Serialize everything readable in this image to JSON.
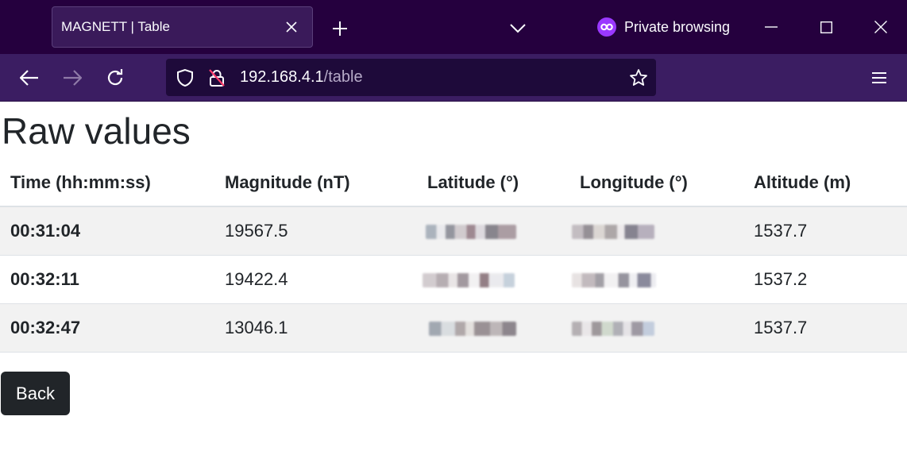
{
  "browser": {
    "tab_title": "MAGNETT | Table",
    "private_label": "Private browsing",
    "url_host": "192.168.4.1",
    "url_path": "/table",
    "icons": {
      "tab_close": "close-icon",
      "new_tab": "plus-icon",
      "tab_list": "chevron-down-icon",
      "private": "private-mask-icon",
      "minimize": "minimize-icon",
      "maximize": "maximize-icon",
      "close": "close-icon",
      "back": "arrow-left-icon",
      "forward": "arrow-right-icon",
      "reload": "reload-icon",
      "shield": "shield-icon",
      "insecure": "insecure-lock-icon",
      "bookmark": "star-icon",
      "menu": "hamburger-menu-icon"
    },
    "colors": {
      "titlebar": "#25003e",
      "toolbar": "#3b1d62",
      "urlbar": "#1e0a3a",
      "private_accent": "#9a38ff"
    }
  },
  "page": {
    "title": "Raw values",
    "table": {
      "headers": [
        "Time (hh:mm:ss)",
        "Magnitude (nT)",
        "Latitude (°)",
        "Longitude (°)",
        "Altitude (m)"
      ],
      "rows": [
        {
          "time": "00:31:04",
          "magnitude": "19567.5",
          "altitude": "1537.7"
        },
        {
          "time": "00:32:11",
          "magnitude": "19422.4",
          "altitude": "1537.2"
        },
        {
          "time": "00:32:47",
          "magnitude": "13046.1",
          "altitude": "1537.7"
        }
      ],
      "redacted_columns": [
        "latitude",
        "longitude"
      ]
    },
    "back_label": "Back",
    "colors": {
      "text": "#212529",
      "stripe": "#f2f2f2",
      "button": "#212529"
    }
  }
}
